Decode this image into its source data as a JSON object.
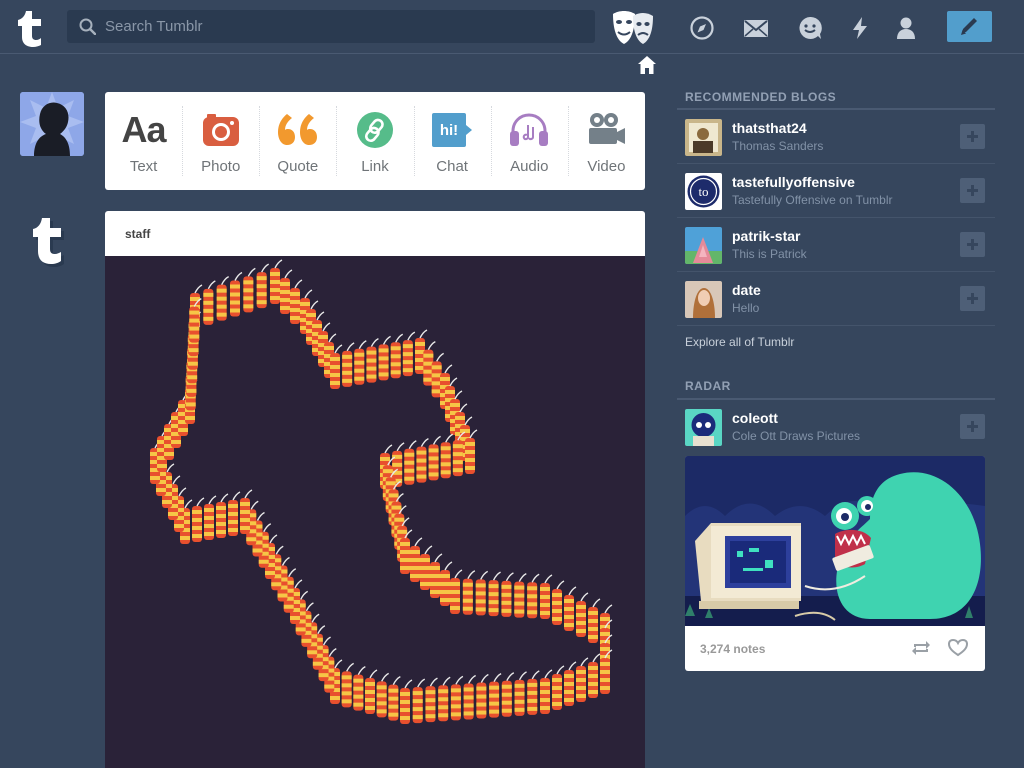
{
  "topbar": {
    "search_placeholder": "Search Tumblr",
    "nav_icons": [
      "explore-icon",
      "inbox-icon",
      "messaging-icon",
      "activity-icon",
      "account-icon"
    ],
    "compose_icon": "pencil-icon",
    "accent_color": "#529ecc"
  },
  "post_types": [
    {
      "label": "Text",
      "icon": "text-icon",
      "color": "#444444"
    },
    {
      "label": "Photo",
      "icon": "camera-icon",
      "color": "#d95e40"
    },
    {
      "label": "Quote",
      "icon": "quote-icon",
      "color": "#f2992e"
    },
    {
      "label": "Link",
      "icon": "link-icon",
      "color": "#56bc8a"
    },
    {
      "label": "Chat",
      "icon": "chat-icon",
      "color": "#529ecc"
    },
    {
      "label": "Audio",
      "icon": "headphones-icon",
      "color": "#a77dc2"
    },
    {
      "label": "Video",
      "icon": "video-camera-icon",
      "color": "#748089"
    }
  ],
  "post": {
    "author": "staff"
  },
  "sidebar": {
    "recommended_title": "RECOMMENDED BLOGS",
    "blogs": [
      {
        "name": "thatsthat24",
        "title": "Thomas Sanders"
      },
      {
        "name": "tastefullyoffensive",
        "title": "Tastefully Offensive on Tumblr"
      },
      {
        "name": "patrik-star",
        "title": "This is Patrick"
      },
      {
        "name": "date",
        "title": "Hello"
      }
    ],
    "explore_label": "Explore all of Tumblr",
    "radar_title": "RADAR",
    "radar": {
      "name": "coleott",
      "title": "Cole Ott Draws Pictures",
      "notes": "3,274 notes"
    }
  }
}
